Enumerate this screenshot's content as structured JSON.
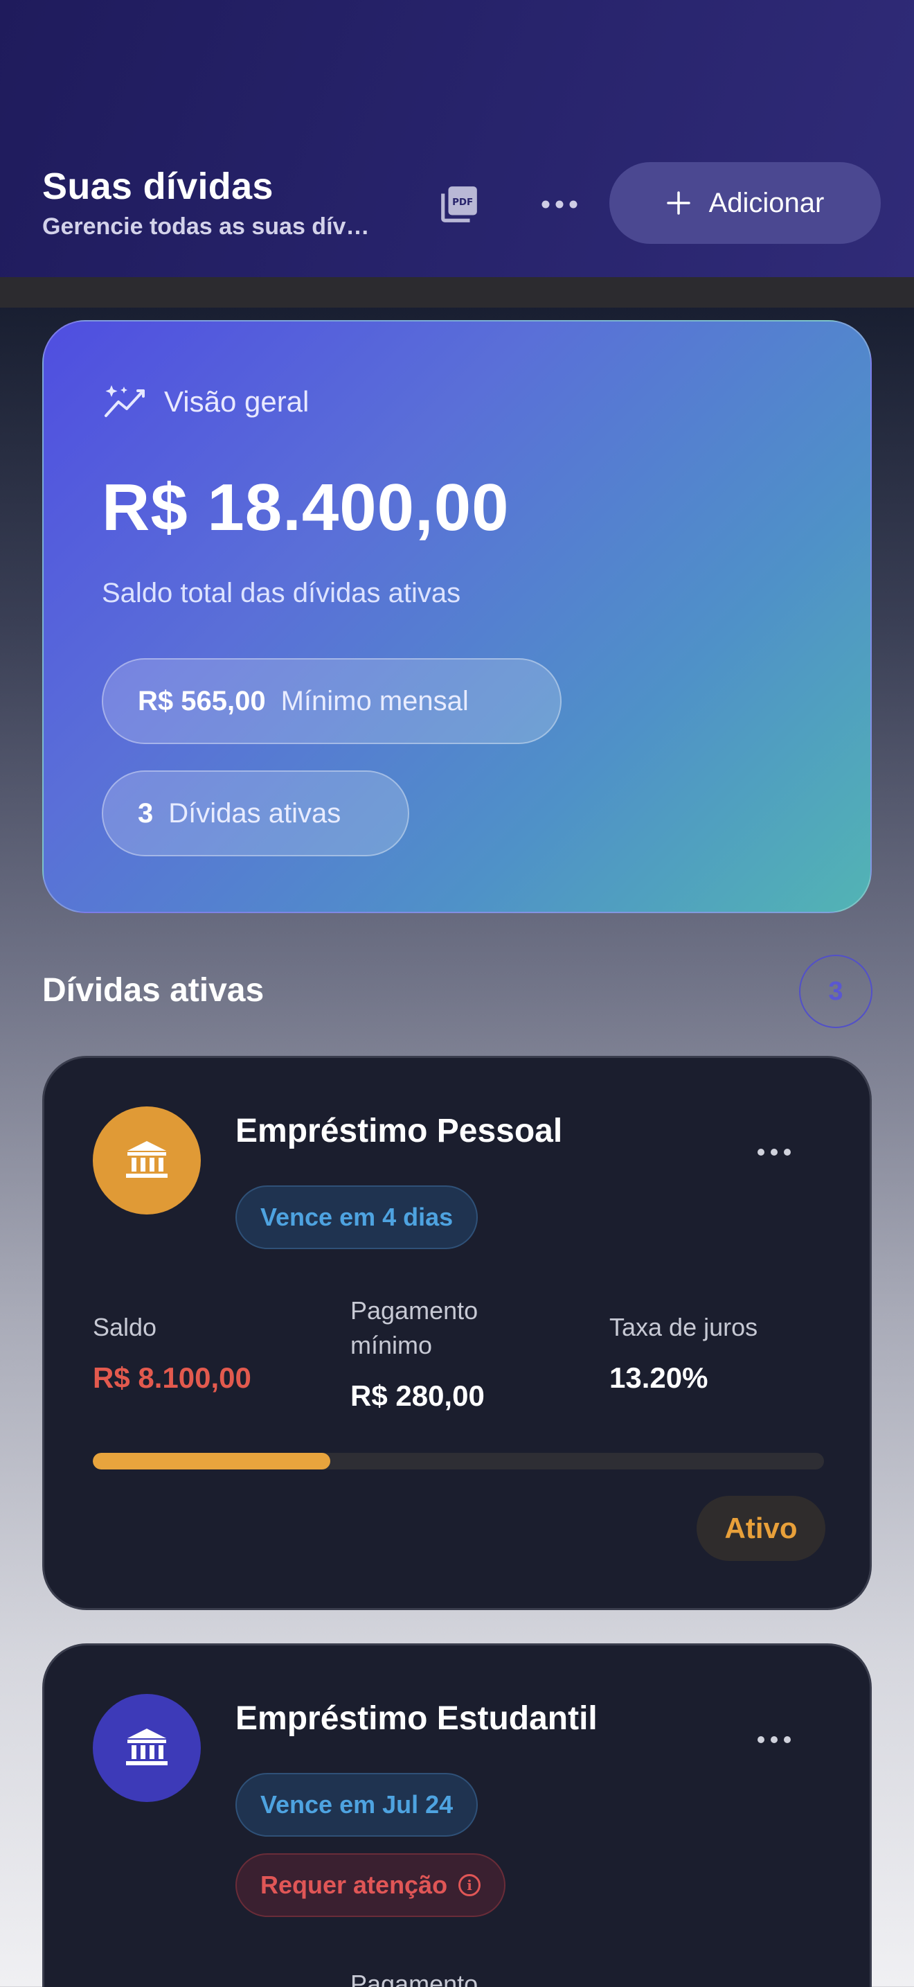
{
  "header": {
    "title": "Suas dívidas",
    "subtitle": "Gerencie todas as suas dívidas",
    "pdf_icon": "pdf-icon",
    "more_icon": "more-horizontal-icon",
    "add_label": "Adicionar",
    "add_icon": "plus-icon"
  },
  "overview": {
    "label": "Visão geral",
    "icon": "sparkle-chart-icon",
    "total_amount": "R$ 18.400,00",
    "description": "Saldo total das dívidas ativas",
    "minimum_value": "R$ 565,00",
    "minimum_label": "Mínimo mensal",
    "active_count": "3",
    "active_label": "Dívidas ativas"
  },
  "section": {
    "title": "Dívidas ativas",
    "count": "3"
  },
  "debts": [
    {
      "name": "Empréstimo Pessoal",
      "icon": "bank-icon",
      "icon_color": "#e09a36",
      "due": "Vence em 4 dias",
      "balance_label": "Saldo",
      "balance": "R$ 8.100,00",
      "balance_color": "#e35a4e",
      "minimum_label": "Pagamento mínimo",
      "minimum": "R$ 280,00",
      "rate_label": "Taxa de juros",
      "rate": "13.20%",
      "progress": 0.325,
      "status": "Ativo"
    },
    {
      "name": "Empréstimo Estudantil",
      "icon": "bank-icon",
      "icon_color": "#3d3ab8",
      "due": "Vence em Jul 24",
      "attention": "Requer atenção",
      "minimum_label": "Pagamento mínimo"
    }
  ],
  "colors": {
    "accent": "#4b4891",
    "warning": "#e8a43d",
    "danger": "#e05656",
    "info": "#4ea3e0"
  }
}
